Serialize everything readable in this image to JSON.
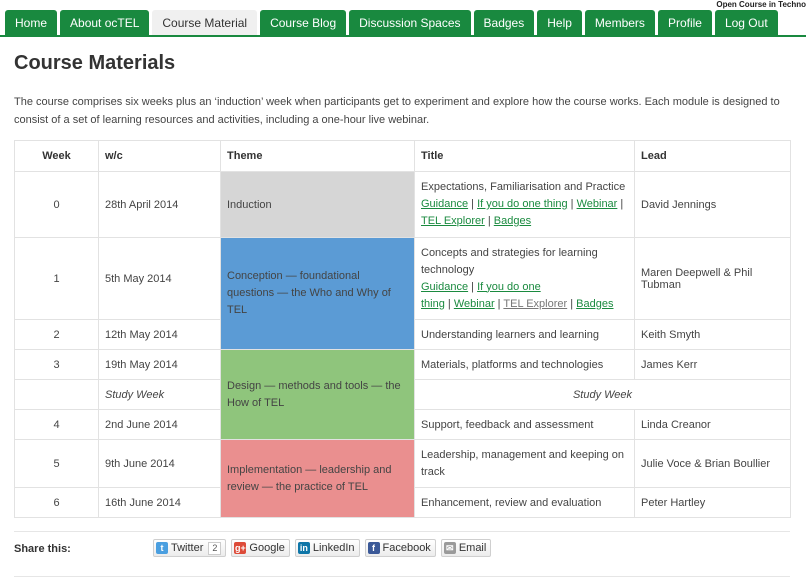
{
  "header": {
    "site_name": "Open Course in Techno"
  },
  "nav": {
    "tabs": [
      {
        "label": "Home",
        "active": false
      },
      {
        "label": "About ocTEL",
        "active": false
      },
      {
        "label": "Course Material",
        "active": true
      },
      {
        "label": "Course Blog",
        "active": false
      },
      {
        "label": "Discussion Spaces",
        "active": false
      },
      {
        "label": "Badges",
        "active": false
      },
      {
        "label": "Help",
        "active": false
      },
      {
        "label": "Members",
        "active": false
      },
      {
        "label": "Profile",
        "active": false
      },
      {
        "label": "Log Out",
        "active": false
      }
    ]
  },
  "page": {
    "title": "Course Materials",
    "intro": "The course comprises six weeks plus an ‘induction’ week when participants get to experiment and explore how the course works. Each module is designed to consist of a set of learning resources and activities, including a one-hour live webinar."
  },
  "table": {
    "headers": {
      "week": "Week",
      "wc": "w/c",
      "theme": "Theme",
      "title": "Title",
      "lead": "Lead"
    },
    "themes": {
      "induction": "Induction",
      "conception": "Conception — foundational questions — the Who and Why of TEL",
      "design": "Design — methods and tools — the How of TEL",
      "implementation": "Implementation — leadership and review — the practice of TEL"
    },
    "rows": [
      {
        "week": "0",
        "wc": "28th April 2014",
        "title": "Expectations, Familiarisation and Practice",
        "lead": "David Jennings"
      },
      {
        "week": "1",
        "wc": "5th May 2014",
        "title": "Concepts and strategies for learning technology",
        "lead": "Maren Deepwell & Phil Tubman"
      },
      {
        "week": "2",
        "wc": "12th May 2014",
        "title": "Understanding learners and learning",
        "lead": "Keith Smyth"
      },
      {
        "week": "3",
        "wc": "19th May 2014",
        "title": "Materials, platforms and technologies",
        "lead": "James Kerr"
      },
      {
        "week": "",
        "wc": "Study Week",
        "title": "Study Week",
        "lead": ""
      },
      {
        "week": "4",
        "wc": "2nd June 2014",
        "title": "Support, feedback and assessment",
        "lead": "Linda Creanor"
      },
      {
        "week": "5",
        "wc": "9th June 2014",
        "title": "Leadership, management and keeping on track",
        "lead": "Julie Voce & Brian Boullier"
      },
      {
        "week": "6",
        "wc": "16th June 2014",
        "title": "Enhancement, review and evaluation",
        "lead": "Peter Hartley"
      }
    ],
    "links": {
      "guidance": "Guidance",
      "if_you_do": "If you do one thing",
      "if_you_do_a": "If you do one",
      "if_you_do_b": "thing",
      "webinar": "Webinar",
      "tel_explorer": "TEL Explorer",
      "badges": "Badges",
      "sep": "|"
    },
    "colors": {
      "induction": "#d6d6d6",
      "conception": "#5b9bd5",
      "design": "#8fc57c",
      "implementation": "#ea8f8f"
    }
  },
  "share": {
    "label": "Share this:",
    "buttons": [
      {
        "label": "Twitter",
        "icon": "twitter-icon",
        "count": "2"
      },
      {
        "label": "Google",
        "icon": "google-plus-icon"
      },
      {
        "label": "LinkedIn",
        "icon": "linkedin-icon"
      },
      {
        "label": "Facebook",
        "icon": "facebook-icon"
      },
      {
        "label": "Email",
        "icon": "email-icon"
      }
    ]
  }
}
